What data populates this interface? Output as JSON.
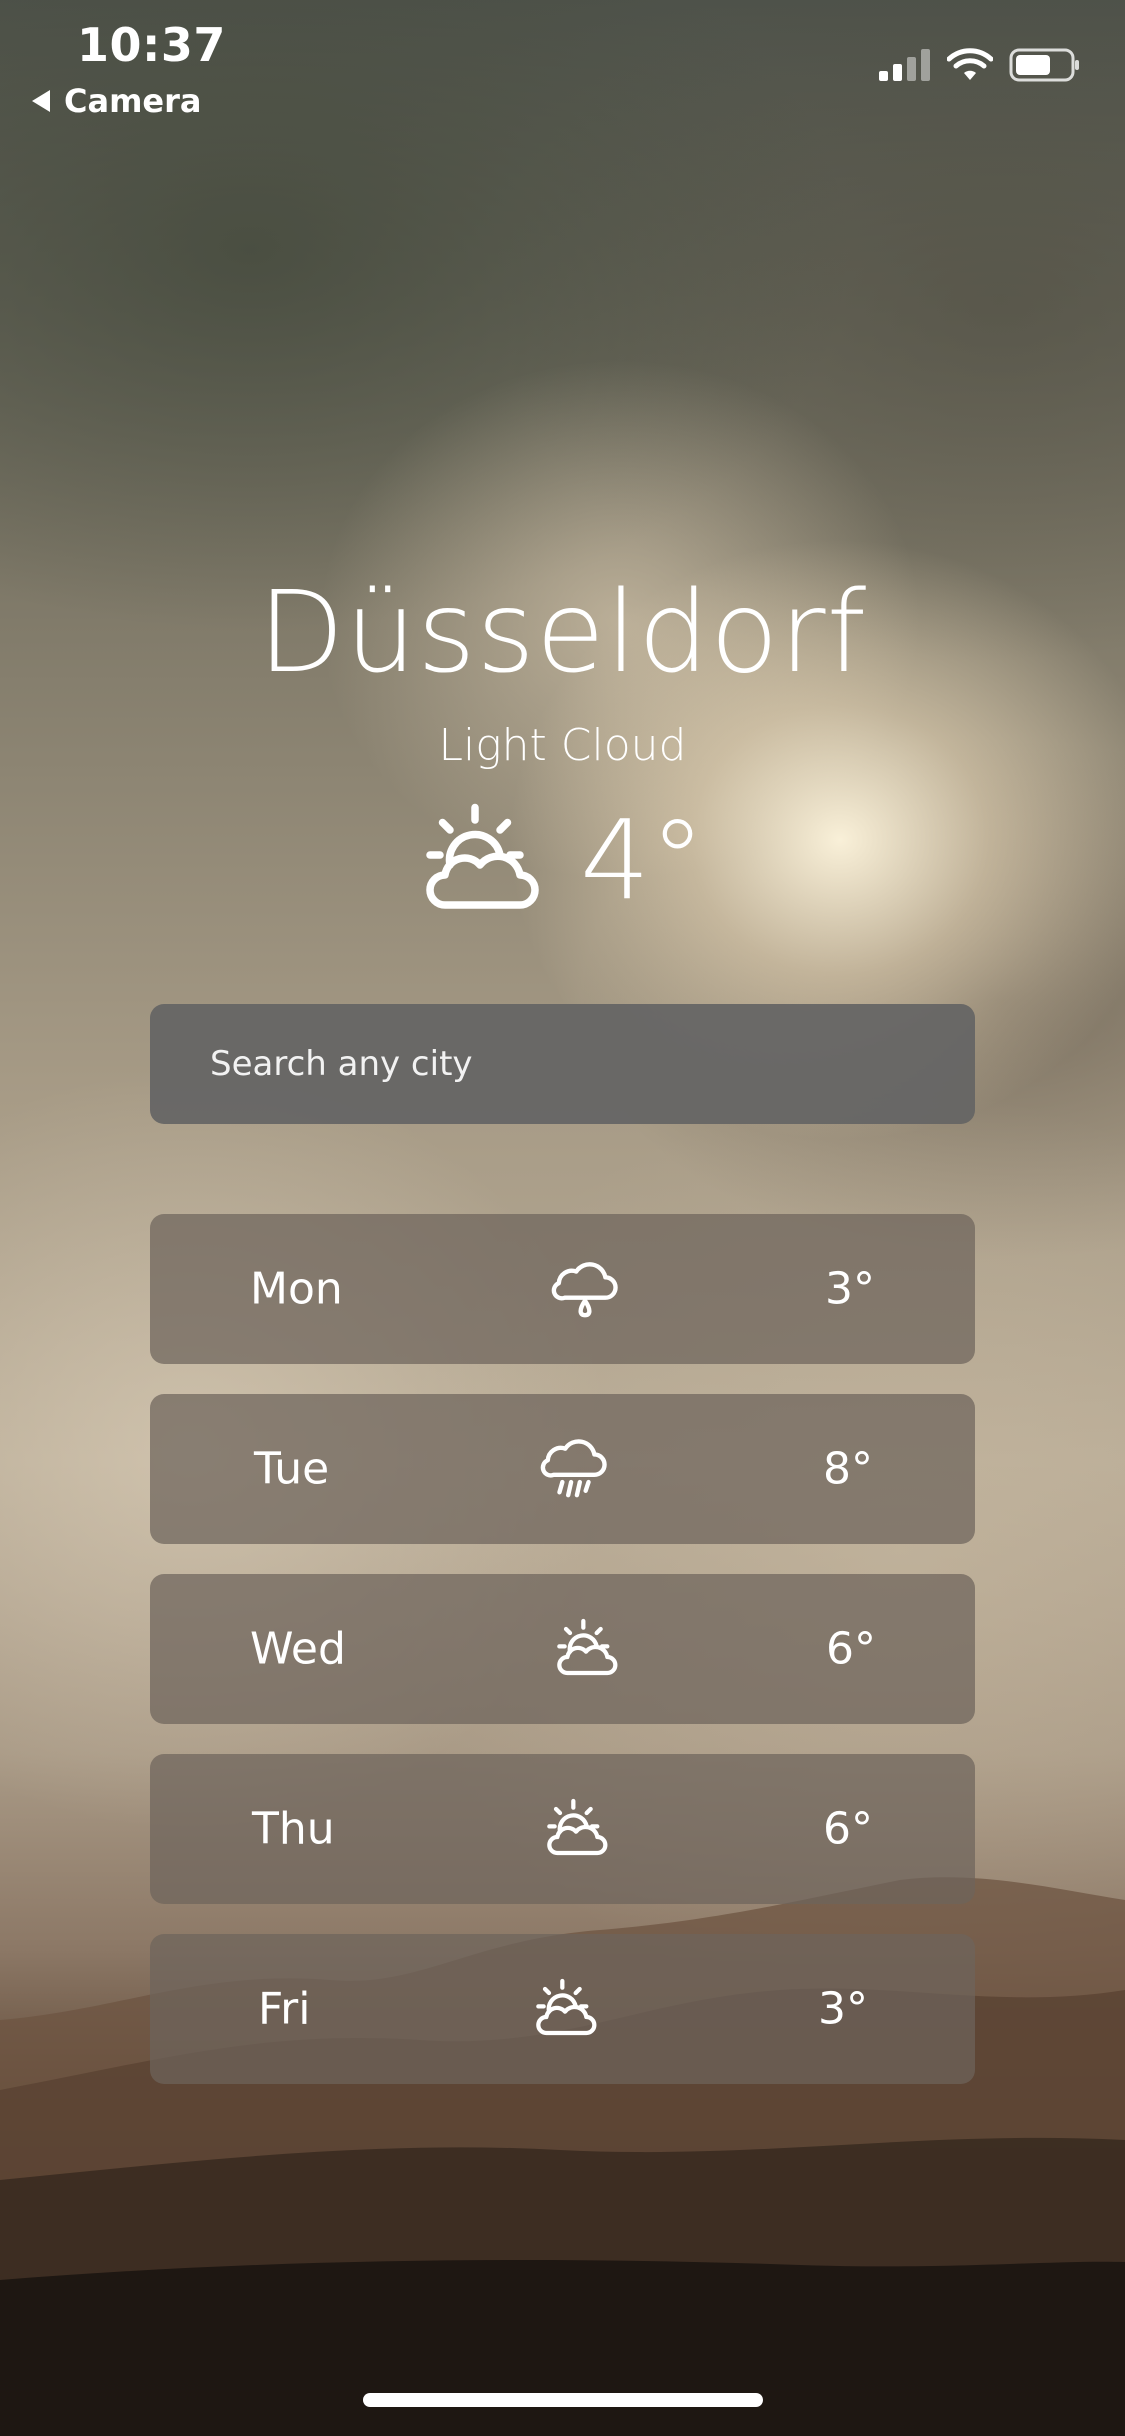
{
  "status_bar": {
    "time": "10:37",
    "back_label": "Camera"
  },
  "weather": {
    "city": "Düsseldorf",
    "condition": "Light Cloud",
    "current_temp": "4°",
    "current_icon": "partly-cloudy-sun-icon"
  },
  "search": {
    "placeholder": "Search any city",
    "value": ""
  },
  "forecast": [
    {
      "day": "Mon",
      "icon": "cloud-rain-drop-icon",
      "temp": "3°"
    },
    {
      "day": "Tue",
      "icon": "cloud-rain-icon",
      "temp": "8°"
    },
    {
      "day": "Wed",
      "icon": "partly-cloudy-sun-icon",
      "temp": "6°"
    },
    {
      "day": "Thu",
      "icon": "partly-cloudy-sun-icon",
      "temp": "6°"
    },
    {
      "day": "Fri",
      "icon": "partly-cloudy-sun-icon",
      "temp": "3°"
    }
  ],
  "colors": {
    "search_bg": "#646464",
    "row_bg": "#6e645c",
    "text": "#ffffff"
  }
}
